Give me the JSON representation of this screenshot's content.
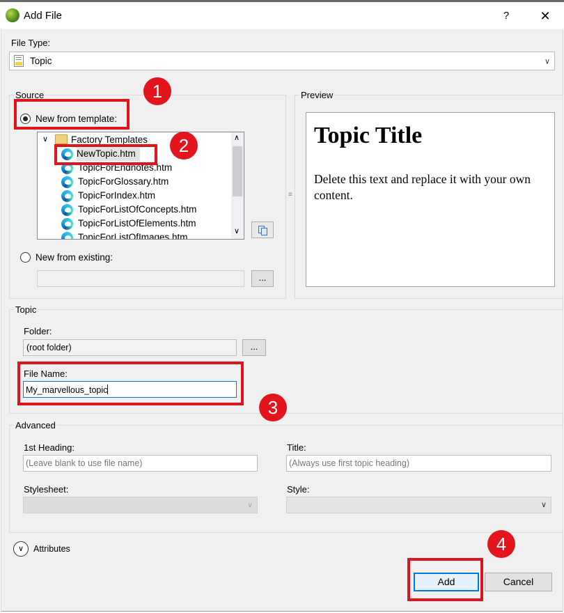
{
  "window": {
    "title": "Add File",
    "help_label": "?",
    "close_label": "✕"
  },
  "file_type": {
    "label": "File Type:",
    "value": "Topic"
  },
  "source": {
    "group_title": "Source",
    "new_from_template_label": "New from template:",
    "new_from_template_checked": true,
    "tree": {
      "folder": "Factory Templates",
      "items": [
        "NewTopic.htm",
        "TopicForEndnotes.htm",
        "TopicForGlossary.htm",
        "TopicForIndex.htm",
        "TopicForListOfConcepts.htm",
        "TopicForListOfElements.htm",
        "TopicForListOfImages.htm"
      ],
      "selected_index": 0
    },
    "new_from_existing_label": "New from existing:",
    "new_from_existing_checked": false,
    "existing_path_value": "",
    "browse_label": "..."
  },
  "preview": {
    "group_title": "Preview",
    "heading": "Topic Title",
    "body": "Delete this text and replace it with your own content."
  },
  "topic": {
    "group_title": "Topic",
    "folder_label": "Folder:",
    "folder_value": "(root folder)",
    "folder_browse_label": "...",
    "file_name_label": "File Name:",
    "file_name_value": "My_marvellous_topic"
  },
  "advanced": {
    "group_title": "Advanced",
    "first_heading_label": "1st Heading:",
    "first_heading_placeholder": "(Leave blank to use file name)",
    "title_label": "Title:",
    "title_placeholder": "(Always use first topic heading)",
    "stylesheet_label": "Stylesheet:",
    "style_label": "Style:"
  },
  "attributes": {
    "label": "Attributes"
  },
  "buttons": {
    "add": "Add",
    "cancel": "Cancel"
  },
  "annotations": {
    "badge1": "1",
    "badge2": "2",
    "badge3": "3",
    "badge4": "4"
  },
  "colors": {
    "highlight_red": "#e0141c",
    "focus_blue": "#0078d7",
    "dialog_bg": "#f0f0f0"
  }
}
